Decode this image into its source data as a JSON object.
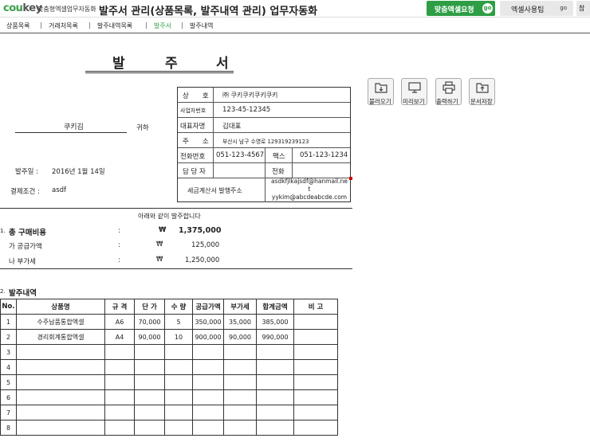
{
  "app": {
    "logo_main": "coukey",
    "logo_main_a": "cou",
    "logo_main_b": "key",
    "brand": "맞춤형엑셀업무자동화",
    "title": "발주서 관리(상품목록, 발주내역 관리) 업무자동화",
    "custom_excel_button": "맞춤엑셀요청",
    "custom_excel_go": "go",
    "excel_tips_button": "엑셀사용팁",
    "excel_tips_go": "go",
    "edge_button": "참"
  },
  "nav": {
    "items": [
      "상품목록",
      "거래처목록",
      "발주내역목록",
      "발주서",
      "발주내역"
    ],
    "separator": "|",
    "active": "발주서"
  },
  "document": {
    "title_chars": [
      "발",
      "주",
      "서"
    ],
    "recipient": "쿠키김",
    "honorific": "귀하",
    "order_date_label": "발주일 :",
    "order_date": "2016년 1월 14일",
    "payment_label": "결제조건 :",
    "payment": "asdf",
    "order_notice": "아래와 같이 발주합니다"
  },
  "supplier": {
    "company_label": "상　　호",
    "company": "㈜ 쿠키쿠키쿠키쿠키",
    "bizno_label": "사업자번호",
    "bizno": "123-45-12345",
    "ceo_label": "대표자명",
    "ceo": "김대표",
    "address_label": "주　　소",
    "address": "부산시 남구 수영로 129319239123",
    "phone_label": "전화번호",
    "phone": "051-123-4567",
    "fax_label": "팩스",
    "fax": "051-123-1234",
    "manager_label": "담 당 자",
    "manager": "",
    "manager_phone_label": "전화",
    "manager_phone": "",
    "tax_email_label": "세금계산서 발행주소",
    "tax_email_line1": "asdkfjlkajsdf@hanmail.ne",
    "tax_email_line2": "t",
    "tax_email_line3": "yykim@abcdeabcde.com"
  },
  "actions": [
    {
      "label": "불러오기",
      "icon": "folder-download-icon"
    },
    {
      "label": "미리보기",
      "icon": "monitor-icon"
    },
    {
      "label": "출력하기",
      "icon": "printer-icon"
    },
    {
      "label": "문서저장",
      "icon": "folder-upload-icon"
    }
  ],
  "summary": {
    "section1_number": "1.",
    "total_label": "총 구매비용",
    "colon": ":",
    "currency": "₩",
    "total": "1,375,000",
    "supply_label": "가 공급가액",
    "supply": "125,000",
    "vat_label": "나 부가세",
    "vat": "1,250,000"
  },
  "items": {
    "section2_number": "2.",
    "section_title": "발주내역",
    "headers": [
      "No.",
      "상품명",
      "규 격",
      "단 가",
      "수 량",
      "공급가액",
      "부가세",
      "합계금액",
      "비 고"
    ],
    "rows": [
      [
        "1",
        "수주납품통합엑셀",
        "A6",
        "70,000",
        "5",
        "350,000",
        "35,000",
        "385,000",
        ""
      ],
      [
        "2",
        "경리회계통합엑셀",
        "A4",
        "90,000",
        "10",
        "900,000",
        "90,000",
        "990,000",
        ""
      ],
      [
        "3",
        "",
        "",
        "",
        "",
        "",
        "",
        "",
        ""
      ],
      [
        "4",
        "",
        "",
        "",
        "",
        "",
        "",
        "",
        ""
      ],
      [
        "5",
        "",
        "",
        "",
        "",
        "",
        "",
        "",
        ""
      ],
      [
        "6",
        "",
        "",
        "",
        "",
        "",
        "",
        "",
        ""
      ],
      [
        "7",
        "",
        "",
        "",
        "",
        "",
        "",
        "",
        ""
      ],
      [
        "8",
        "",
        "",
        "",
        "",
        "",
        "",
        "",
        ""
      ]
    ]
  },
  "colors": {
    "accent_green": "#2e9e45",
    "border": "#333333"
  }
}
